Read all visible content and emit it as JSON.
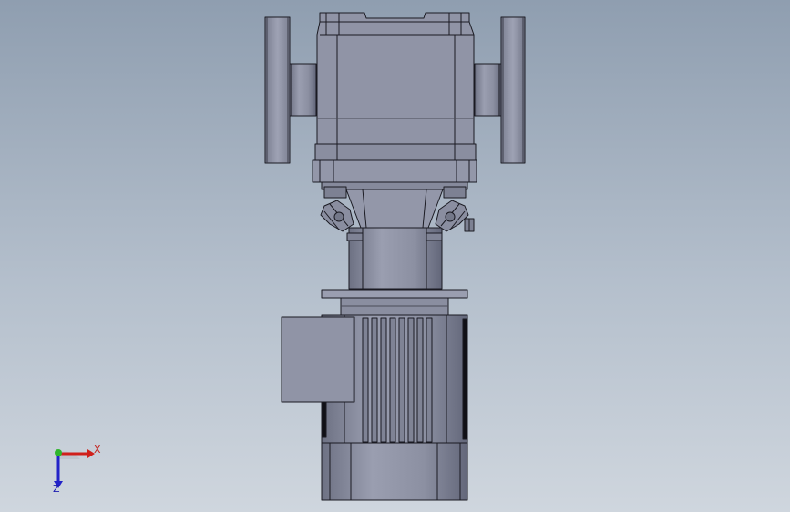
{
  "viewport": {
    "background_top": "#8f9eb0",
    "background_bottom": "#cfd6de",
    "model_color": "#8d91a3",
    "edge_color": "#1a1a22"
  },
  "triad": {
    "x_label": "X",
    "z_label": "Z",
    "x_color": "#d0201b",
    "y_color": "#2fb52c",
    "z_color": "#2222c8"
  }
}
